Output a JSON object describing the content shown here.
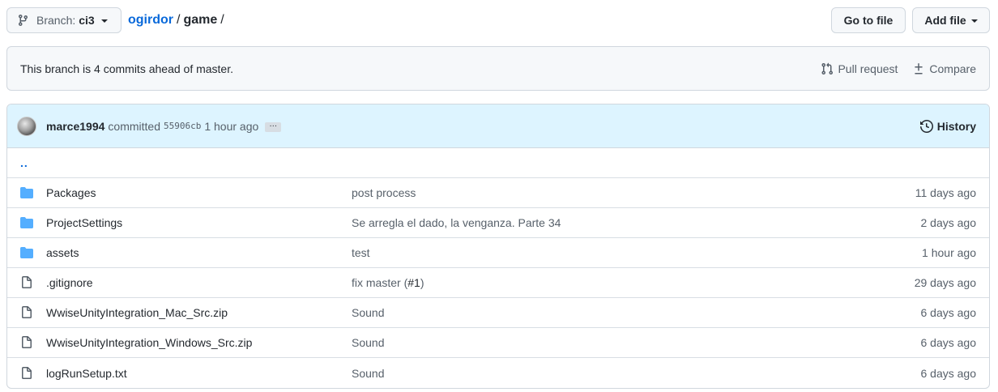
{
  "branch": {
    "prefix": "Branch:",
    "name": "ci3"
  },
  "breadcrumb": {
    "repo": "ogirdor",
    "sep1": "/",
    "dir": "game",
    "sep2": "/"
  },
  "buttons": {
    "go_to_file": "Go to file",
    "add_file": "Add file"
  },
  "ahead": {
    "message": "This branch is 4 commits ahead of master.",
    "pull_request": "Pull request",
    "compare": "Compare"
  },
  "commit": {
    "author": "marce1994",
    "verb": "committed",
    "sha": "55906cb",
    "ago": "1 hour ago",
    "ellipsis": "…",
    "history": "History"
  },
  "up_dir": "..",
  "files": [
    {
      "type": "dir",
      "name": "Packages",
      "message": "post process",
      "age": "11 days ago"
    },
    {
      "type": "dir",
      "name": "ProjectSettings",
      "message": "Se arregla el dado, la venganza. Parte 34",
      "age": "2 days ago"
    },
    {
      "type": "dir",
      "name": "assets",
      "message": "test",
      "age": "1 hour ago"
    },
    {
      "type": "file",
      "name": ".gitignore",
      "message": "fix master (",
      "pr": "#1",
      "message_end": ")",
      "age": "29 days ago"
    },
    {
      "type": "file",
      "name": "WwiseUnityIntegration_Mac_Src.zip",
      "message": "Sound",
      "age": "6 days ago"
    },
    {
      "type": "file",
      "name": "WwiseUnityIntegration_Windows_Src.zip",
      "message": "Sound",
      "age": "6 days ago"
    },
    {
      "type": "file",
      "name": "logRunSetup.txt",
      "message": "Sound",
      "age": "6 days ago"
    }
  ],
  "colors": {
    "link": "#0969da",
    "folder": "#54aeff",
    "file_icon": "#57606a",
    "commit_bg": "#ddf4ff",
    "banner_bg": "#f6f8fa"
  },
  "icons": {
    "branch": "git-branch-icon",
    "pull_request": "git-pull-request-icon",
    "compare": "diff-icon",
    "history": "history-icon",
    "folder": "folder-icon",
    "file": "file-icon"
  }
}
